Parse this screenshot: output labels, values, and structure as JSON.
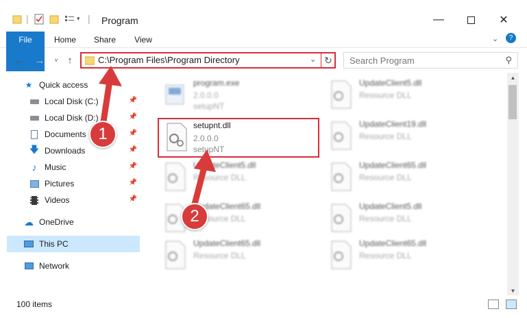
{
  "window": {
    "title": "Program",
    "minimize_icon": "minimize-icon",
    "maximize_icon": "maximize-icon",
    "close_icon": "close-icon"
  },
  "ribbon": {
    "tabs": [
      {
        "label": "File"
      },
      {
        "label": "Home"
      },
      {
        "label": "Share"
      },
      {
        "label": "View"
      }
    ],
    "help_icon": "help-icon",
    "expand_icon": "chevron-down-icon"
  },
  "address_bar": {
    "path": "C:\\Program Files\\Program Directory",
    "highlight_color": "#d92b37"
  },
  "search": {
    "placeholder": "Search Program"
  },
  "sidebar": {
    "items": [
      {
        "label": "Quick access",
        "icon": "star-icon",
        "pinned": false
      },
      {
        "label": "Local Disk (C:)",
        "icon": "drive-icon",
        "pinned": true
      },
      {
        "label": "Local Disk (D:)",
        "icon": "drive-icon",
        "pinned": true
      },
      {
        "label": "Documents",
        "icon": "documents-icon",
        "pinned": true
      },
      {
        "label": "Downloads",
        "icon": "downloads-icon",
        "pinned": true
      },
      {
        "label": "Music",
        "icon": "music-icon",
        "pinned": true
      },
      {
        "label": "Pictures",
        "icon": "pictures-icon",
        "pinned": true
      },
      {
        "label": "Videos",
        "icon": "videos-icon",
        "pinned": true
      },
      {
        "label": "OneDrive",
        "icon": "onedrive-icon",
        "pinned": false
      },
      {
        "label": "This PC",
        "icon": "computer-icon",
        "pinned": false,
        "selected": true
      },
      {
        "label": "Network",
        "icon": "network-icon",
        "pinned": false
      }
    ]
  },
  "files": {
    "left": [
      {
        "name": "program.exe",
        "version": "2.0.0.0",
        "description": "setupNT",
        "blurred": true
      },
      {
        "name": "setupnt.dll",
        "version": "2.0.0.0",
        "description": "setupNT",
        "blurred": false,
        "highlighted": true
      },
      {
        "name": "UpdateClient5.dll",
        "version": "",
        "description": "Resource DLL",
        "blurred": true
      },
      {
        "name": "UpdateClient65.dll",
        "version": "",
        "description": "Resource DLL",
        "blurred": true
      },
      {
        "name": "UpdateClient65.dll",
        "version": "",
        "description": "Resource DLL",
        "blurred": true
      }
    ],
    "right": [
      {
        "name": "UpdateClient5.dll",
        "description": "Resource DLL"
      },
      {
        "name": "UpdateClient19.dll",
        "description": "Resource DLL"
      },
      {
        "name": "UpdateClient65.dll",
        "description": "Resource DLL"
      },
      {
        "name": "UpdateClient5.dll",
        "description": "Resource DLL"
      },
      {
        "name": "UpdateClient65.dll",
        "description": "Resource DLL"
      }
    ]
  },
  "status_bar": {
    "item_count": "100 items"
  },
  "callouts": {
    "one": "1",
    "two": "2",
    "color": "#d83b3b"
  }
}
